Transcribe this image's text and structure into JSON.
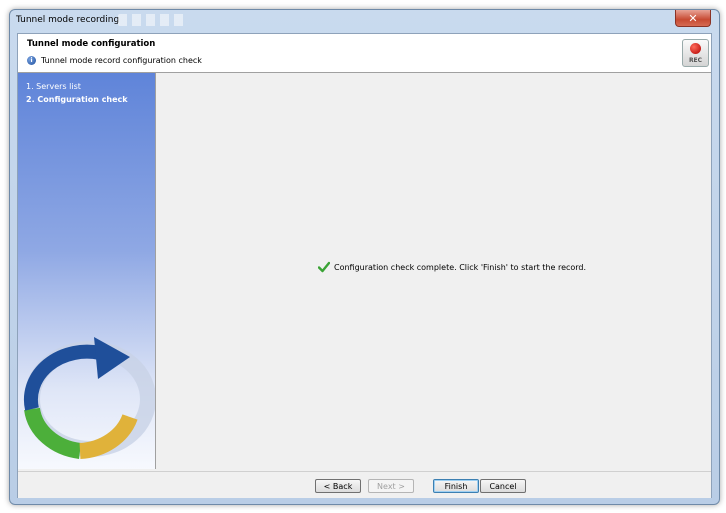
{
  "window": {
    "title": "Tunnel mode recording",
    "close_label": "✕"
  },
  "header": {
    "title": "Tunnel mode configuration",
    "subtitle": "Tunnel mode record configuration check",
    "info_icon": "info-icon",
    "rec_label": "REC"
  },
  "steps": [
    {
      "label": "1. Servers list",
      "active": false
    },
    {
      "label": "2. Configuration check",
      "active": true
    }
  ],
  "main": {
    "message": "Configuration check complete. Click 'Finish' to start the record.",
    "status_icon": "check-icon"
  },
  "buttons": {
    "back": "< Back",
    "next": "Next >",
    "finish": "Finish",
    "cancel": "Cancel"
  },
  "colors": {
    "accent": "#3c7fb1",
    "sidebar_top": "#5f84d9",
    "check_green": "#3aa335"
  }
}
